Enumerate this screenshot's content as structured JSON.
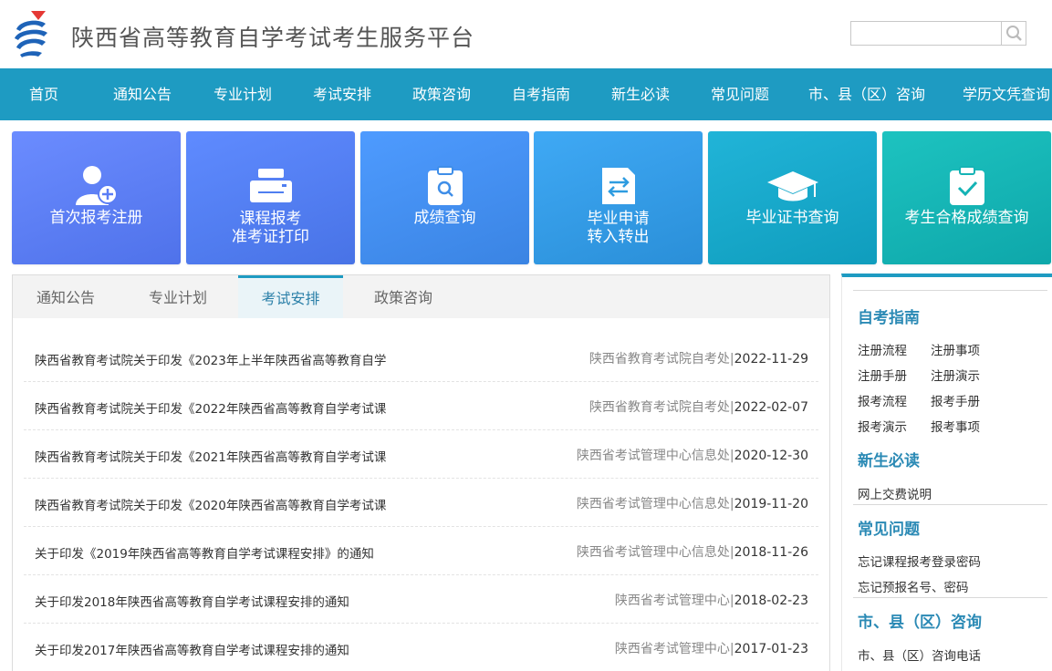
{
  "header": {
    "site_title": "陕西省高等教育自学考试考生服务平台",
    "logo_icon": "provincial-exam-logo",
    "search": {
      "value": "",
      "placeholder": "",
      "button_icon": "search-icon"
    }
  },
  "nav": {
    "items": [
      "首页",
      "通知公告",
      "专业计划",
      "考试安排",
      "政策咨询",
      "自考指南",
      "新生必读",
      "常见问题",
      "市、县（区）咨询",
      "学历文凭查询"
    ]
  },
  "tiles": [
    {
      "lines": [
        "首次报考注册"
      ],
      "icon": "user-add-icon",
      "color": "#5a7df5"
    },
    {
      "lines": [
        "课程报考",
        "准考证打印"
      ],
      "icon": "printer-icon",
      "color": "#4f7ef0"
    },
    {
      "lines": [
        "成绩查询"
      ],
      "icon": "clipboard-search-icon",
      "color": "#3f8ee8"
    },
    {
      "lines": [
        "毕业申请",
        "转入转出"
      ],
      "icon": "document-transfer-icon",
      "color": "#2e9ce0"
    },
    {
      "lines": [
        "毕业证书查询"
      ],
      "icon": "graduation-cap-icon",
      "color": "#16a8c7"
    },
    {
      "lines": [
        "考生合格成绩查询"
      ],
      "icon": "clipboard-check-icon",
      "color": "#14b3b5"
    }
  ],
  "main": {
    "tabs": [
      "通知公告",
      "专业计划",
      "考试安排",
      "政策咨询"
    ],
    "active_tab": "考试安排",
    "news": [
      {
        "title": "陕西省教育考试院关于印发《2023年上半年陕西省高等教育自学",
        "source": "陕西省教育考试院自考处",
        "date": "2022-11-29"
      },
      {
        "title": "陕西省教育考试院关于印发《2022年陕西省高等教育自学考试课",
        "source": "陕西省教育考试院自考处",
        "date": "2022-02-07"
      },
      {
        "title": "陕西省教育考试院关于印发《2021年陕西省高等教育自学考试课",
        "source": "陕西省考试管理中心信息处",
        "date": "2020-12-30"
      },
      {
        "title": "陕西省教育考试院关于印发《2020年陕西省高等教育自学考试课",
        "source": "陕西省考试管理中心信息处",
        "date": "2019-11-20"
      },
      {
        "title": "关于印发《2019年陕西省高等教育自学考试课程安排》的通知",
        "source": "陕西省考试管理中心信息处",
        "date": "2018-11-26"
      },
      {
        "title": "关于印发2018年陕西省高等教育自学考试课程安排的通知",
        "source": "陕西省考试管理中心",
        "date": "2018-02-23"
      },
      {
        "title": "关于印发2017年陕西省高等教育自学考试课程安排的通知",
        "source": "陕西省考试管理中心",
        "date": "2017-01-23"
      }
    ]
  },
  "sidebar": {
    "sections": [
      {
        "heading": "自考指南",
        "links": [
          "注册流程",
          "注册事项",
          "注册手册",
          "注册演示",
          "报考流程",
          "报考手册",
          "报考演示",
          "报考事项"
        ]
      },
      {
        "heading": "新生必读",
        "links": [
          "网上交费说明"
        ]
      },
      {
        "heading": "常见问题",
        "links": [
          "忘记课程报考登录密码",
          "忘记预报名号、密码"
        ]
      },
      {
        "heading": "市、县（区）咨询",
        "links": [
          "市、县（区）咨询电话"
        ]
      }
    ]
  },
  "colors": {
    "nav": "#1e9bc2",
    "accent_text": "#2b8ab5"
  }
}
